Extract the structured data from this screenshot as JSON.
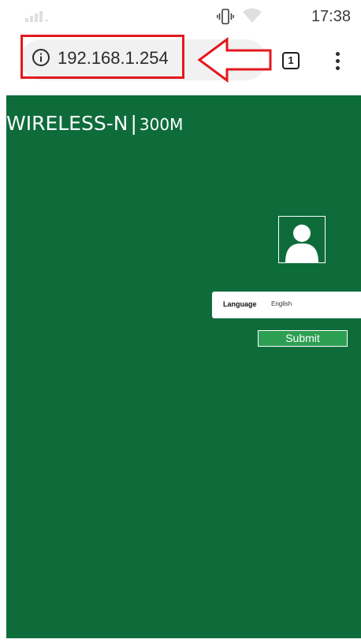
{
  "status_bar": {
    "time": "17:38"
  },
  "browser": {
    "url": "192.168.1.254",
    "tab_count": "1"
  },
  "page": {
    "model": "WIRELESS-N",
    "separator": "|",
    "speed": "300M",
    "language_label": "Language",
    "language_value": "English",
    "submit_label": "Submit"
  },
  "colors": {
    "page_background": "#0e6c3b",
    "submit_background": "#2d9f52",
    "annotation": "#e3181f"
  },
  "icons": [
    "signal-icon",
    "vibrate-icon",
    "wifi-icon",
    "info-icon",
    "tab-switcher-icon",
    "more-menu-icon",
    "user-avatar-icon"
  ]
}
